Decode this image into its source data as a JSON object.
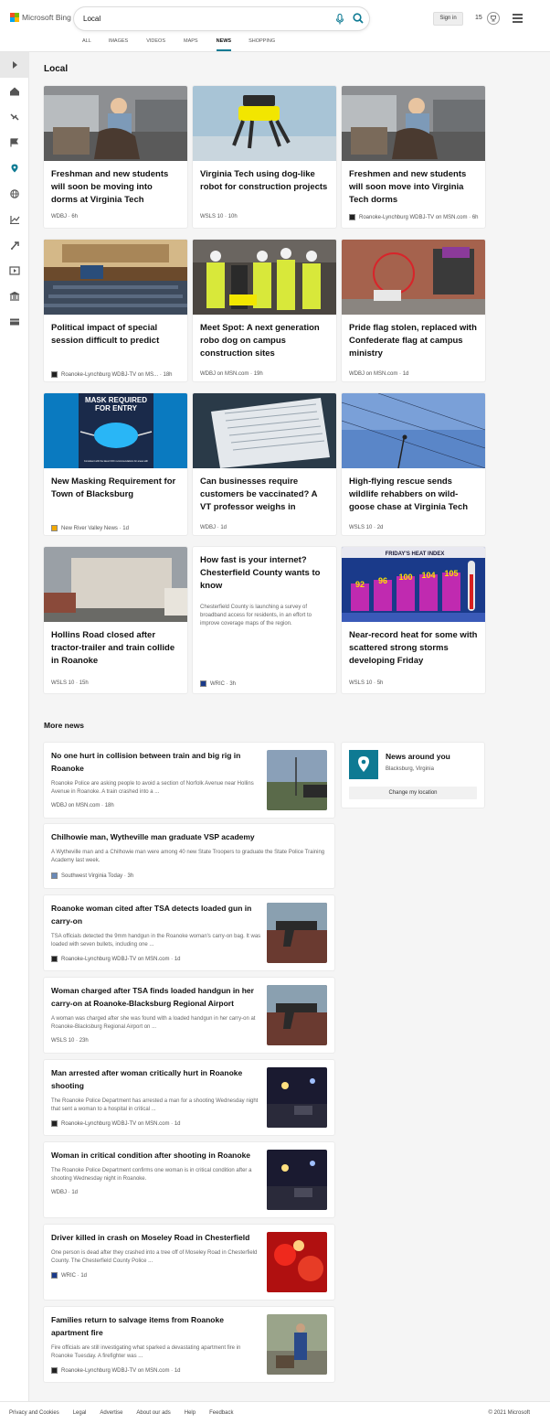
{
  "header": {
    "brand": "Microsoft Bing",
    "brand_colors": [
      "#f25022",
      "#7fba00",
      "#00a4ef",
      "#ffb900"
    ],
    "search_value": "Local",
    "signin_label": "Sign in",
    "rewards_count": "15",
    "icons": [
      "microphone-icon",
      "search-icon",
      "rewards-icon",
      "hamburger-menu-icon"
    ]
  },
  "tabs": [
    {
      "label": "ALL"
    },
    {
      "label": "IMAGES"
    },
    {
      "label": "VIDEOS"
    },
    {
      "label": "MAPS"
    },
    {
      "label": "NEWS",
      "active": true
    },
    {
      "label": "SHOPPING"
    }
  ],
  "accent_color": "#0e7a93",
  "sidebar": {
    "icons": [
      "expand-icon",
      "home-icon",
      "satellite-icon",
      "flag-icon",
      "location-icon",
      "globe-icon",
      "business-icon",
      "science-icon",
      "entertainment-icon",
      "politics-icon",
      "money-icon"
    ]
  },
  "main": {
    "title": "Local",
    "cards": [
      {
        "title": "Freshman and new students will soon be moving into dorms at Virginia Tech",
        "source": "WDBJ",
        "time": "6h",
        "image": "student-with-luggage"
      },
      {
        "title": "Virginia Tech using dog-like robot for construction projects",
        "source": "WSLS 10",
        "time": "10h",
        "image": "yellow-robot-dog"
      },
      {
        "title": "Freshmen and new students will soon move into Virginia Tech dorms",
        "source": "Roanoke-Lynchburg WDBJ-TV on MSN.com",
        "time": "6h",
        "image": "student-with-luggage"
      },
      {
        "title": "Political impact of special session difficult to predict",
        "source": "Roanoke-Lynchburg WDBJ-TV on MS...",
        "time": "18h",
        "image": "legislative-chamber"
      },
      {
        "title": "Meet Spot: A next generation robo dog on campus construction sites",
        "source": "WDBJ on MSN.com",
        "time": "19h",
        "image": "construction-workers"
      },
      {
        "title": "Pride flag stolen, replaced with Confederate flag at campus ministry",
        "source": "WDBJ on MSN.com",
        "time": "1d",
        "image": "brick-building"
      },
      {
        "title": "New Masking Requirement for Town of Blacksburg",
        "source": "New River Valley News",
        "time": "1d",
        "image": "mask-required-sign",
        "image_text_1": "MASK REQUIRED",
        "image_text_2": "FOR ENTRY",
        "image_text_3": "Consistent with the latest CDC recommendations for areas with"
      },
      {
        "title": "Can businesses require customers be vaccinated? A VT professor weighs in",
        "source": "WDBJ",
        "time": "1d",
        "image": "vaccination-card"
      },
      {
        "title": "High-flying rescue sends wildlife rehabbers on wild-goose chase at Virginia Tech",
        "source": "WSLS 10",
        "time": "2d",
        "image": "sky-with-lines"
      },
      {
        "title": "Hollins Road closed after tractor-trailer and train collide in Roanoke",
        "source": "WSLS 10",
        "time": "15h",
        "image": "tractor-trailer"
      },
      {
        "title": "How fast is your internet? Chesterfield County wants to know",
        "snippet": "Chesterfield County is launching a survey of broadband access for residents, in an effort to improve coverage maps of the region.",
        "source": "WRIC",
        "time": "3h"
      },
      {
        "title": "Near-record heat for some with scattered strong storms developing Friday",
        "source": "WSLS 10",
        "time": "5h",
        "image": "heat-index-graphic",
        "image_text": "FRIDAY'S HEAT INDEX",
        "heat_values": [
          "92",
          "96",
          "100",
          "104",
          "105"
        ]
      }
    ]
  },
  "more": {
    "title": "More news",
    "items": [
      {
        "title": "No one hurt in collision between train and big rig in Roanoke",
        "snippet": "Roanoke Police are asking people to avoid a section of Norfolk Avenue near Hollins Avenue in Roanoke. A train crashed into a ...",
        "source": "WDBJ on MSN.com",
        "time": "18h",
        "image": "road-scene"
      },
      {
        "title": "Chilhowie man, Wytheville man graduate VSP academy",
        "snippet": "A Wytheville man and a Chilhowie man were among 40 new State Troopers to graduate the State Police Training Academy last week.",
        "source": "Southwest Virginia Today",
        "time": "3h"
      },
      {
        "title": "Roanoke woman cited after TSA detects loaded gun in carry-on",
        "snippet": "TSA officials detected the 9mm handgun in the Roanoke woman's carry-on bag. It was loaded with seven bullets, including one ...",
        "source": "Roanoke-Lynchburg WDBJ-TV on MSN.com",
        "time": "1d",
        "image": "handgun"
      },
      {
        "title": "Woman charged after TSA finds loaded handgun in her carry-on at Roanoke-Blacksburg Regional Airport",
        "snippet": "A woman was charged after she was found with a loaded handgun in her carry-on at Roanoke-Blacksburg Regional Airport on ...",
        "source": "WSLS 10",
        "time": "23h",
        "image": "handgun"
      },
      {
        "title": "Man arrested after woman critically hurt in Roanoke shooting",
        "snippet": "The Roanoke Police Department has arrested a man for a shooting Wednesday night that sent a woman to a hospital in critical ...",
        "source": "Roanoke-Lynchburg WDBJ-TV on MSN.com",
        "time": "1d",
        "image": "night-scene"
      },
      {
        "title": "Woman in critical condition after shooting in Roanoke",
        "snippet": "The Roanoke Police Department confirms one woman is in critical condition after a shooting Wednesday night in Roanoke.",
        "source": "WDBJ",
        "time": "1d",
        "image": "night-scene"
      },
      {
        "title": "Driver killed in crash on Moseley Road in Chesterfield",
        "snippet": "One person is dead after they crashed into a tree off of Moseley Road in Chesterfield County. The Chesterfield County Police ...",
        "source": "WRIC",
        "time": "1d",
        "image": "emergency-lights"
      },
      {
        "title": "Families return to salvage items from Roanoke apartment fire",
        "snippet": "Fire officials are still investigating what sparked a devastating apartment fire in Roanoke Tuesday. A firefighter was ...",
        "source": "Roanoke-Lynchburg WDBJ-TV on MSN.com",
        "time": "1d",
        "image": "fire-salvage"
      }
    ]
  },
  "around": {
    "title": "News around you",
    "location": "Blacksburg, Virginia",
    "button": "Change my location"
  },
  "footer": {
    "links": [
      "Privacy and Cookies",
      "Legal",
      "Advertise",
      "About our ads",
      "Help",
      "Feedback"
    ],
    "copyright": "© 2021 Microsoft"
  }
}
